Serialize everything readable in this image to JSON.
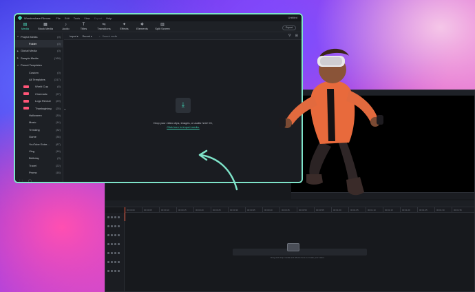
{
  "window": {
    "app_title": "Wondershare Filmora",
    "menu": [
      "File",
      "Edit",
      "Tools",
      "View",
      "Export",
      "Help"
    ],
    "menu_dim": [
      "Export"
    ],
    "doc_title": "Untitled"
  },
  "tabs": [
    {
      "label": "Media",
      "icon": "media-icon",
      "glyph": "▤",
      "active": true
    },
    {
      "label": "Stock Media",
      "icon": "stock-media-icon",
      "glyph": "▦",
      "active": false
    },
    {
      "label": "Audio",
      "icon": "audio-icon",
      "glyph": "♪",
      "active": false
    },
    {
      "label": "Titles",
      "icon": "titles-icon",
      "glyph": "T",
      "active": false
    },
    {
      "label": "Transitions",
      "icon": "transitions-icon",
      "glyph": "⇋",
      "active": false
    },
    {
      "label": "Effects",
      "icon": "effects-icon",
      "glyph": "✦",
      "active": false
    },
    {
      "label": "Elements",
      "icon": "elements-icon",
      "glyph": "❖",
      "active": false
    },
    {
      "label": "Split Screen",
      "icon": "split-screen-icon",
      "glyph": "▥",
      "active": false
    }
  ],
  "export_label": "Export",
  "sidebar": {
    "items": [
      {
        "label": "Project Media",
        "count": "(0)",
        "level": 0,
        "arrow": "▼"
      },
      {
        "label": "Folder",
        "count": "(0)",
        "level": 1,
        "active": true
      },
      {
        "label": "Global Media",
        "count": "(0)",
        "level": 0,
        "arrow": "▶"
      },
      {
        "label": "Sample Media",
        "count": "(166)",
        "level": 0,
        "arrow": "▶"
      },
      {
        "label": "Preset Templates",
        "count": "",
        "level": 0,
        "arrow": "▼"
      },
      {
        "label": "Custom",
        "count": "(0)",
        "level": 1
      },
      {
        "label": "All Templates",
        "count": "(317)",
        "level": 1
      },
      {
        "label": "World Cup",
        "count": "(6)",
        "level": 1,
        "badge": true
      },
      {
        "label": "Cinematic",
        "count": "(97)",
        "level": 1,
        "badge": true
      },
      {
        "label": "Logo Reveal",
        "count": "(29)",
        "level": 1,
        "badge": true
      },
      {
        "label": "Thanksgiving",
        "count": "(25)",
        "level": 1,
        "badge": true
      },
      {
        "label": "Halloween",
        "count": "(30)",
        "level": 1
      },
      {
        "label": "Music",
        "count": "(14)",
        "level": 1
      },
      {
        "label": "Trending",
        "count": "(32)",
        "level": 1
      },
      {
        "label": "Game",
        "count": "(36)",
        "level": 1
      },
      {
        "label": "YouTube Entre...",
        "count": "(87)",
        "level": 1
      },
      {
        "label": "Vlog",
        "count": "(16)",
        "level": 1
      },
      {
        "label": "Birthday",
        "count": "(9)",
        "level": 1
      },
      {
        "label": "Travel",
        "count": "(22)",
        "level": 1
      },
      {
        "label": "Promo",
        "count": "(18)",
        "level": 1
      }
    ]
  },
  "filterbar": {
    "import": "Import",
    "record": "Record",
    "search_placeholder": "Search media"
  },
  "dropzone": {
    "line1": "Drop your video clips, images, or audio here! Or,",
    "line2": "Click here to import media."
  },
  "timeline": {
    "ruler": [
      "00:00:00",
      "00:00:05",
      "00:00:10",
      "00:00:15",
      "00:00:20",
      "00:00:25",
      "00:00:30",
      "00:00:35",
      "00:00:40",
      "00:00:45",
      "00:00:50",
      "00:00:55",
      "00:01:00",
      "00:01:05",
      "00:01:10",
      "00:01:15",
      "00:01:20",
      "00:01:25",
      "00:01:30",
      "00:01:35"
    ],
    "hint": "Drag and drop media and effects here to create your video."
  },
  "colors": {
    "accent": "#4fe0c1",
    "window_border": "#7ee3c9",
    "badge": "#ff5577"
  }
}
